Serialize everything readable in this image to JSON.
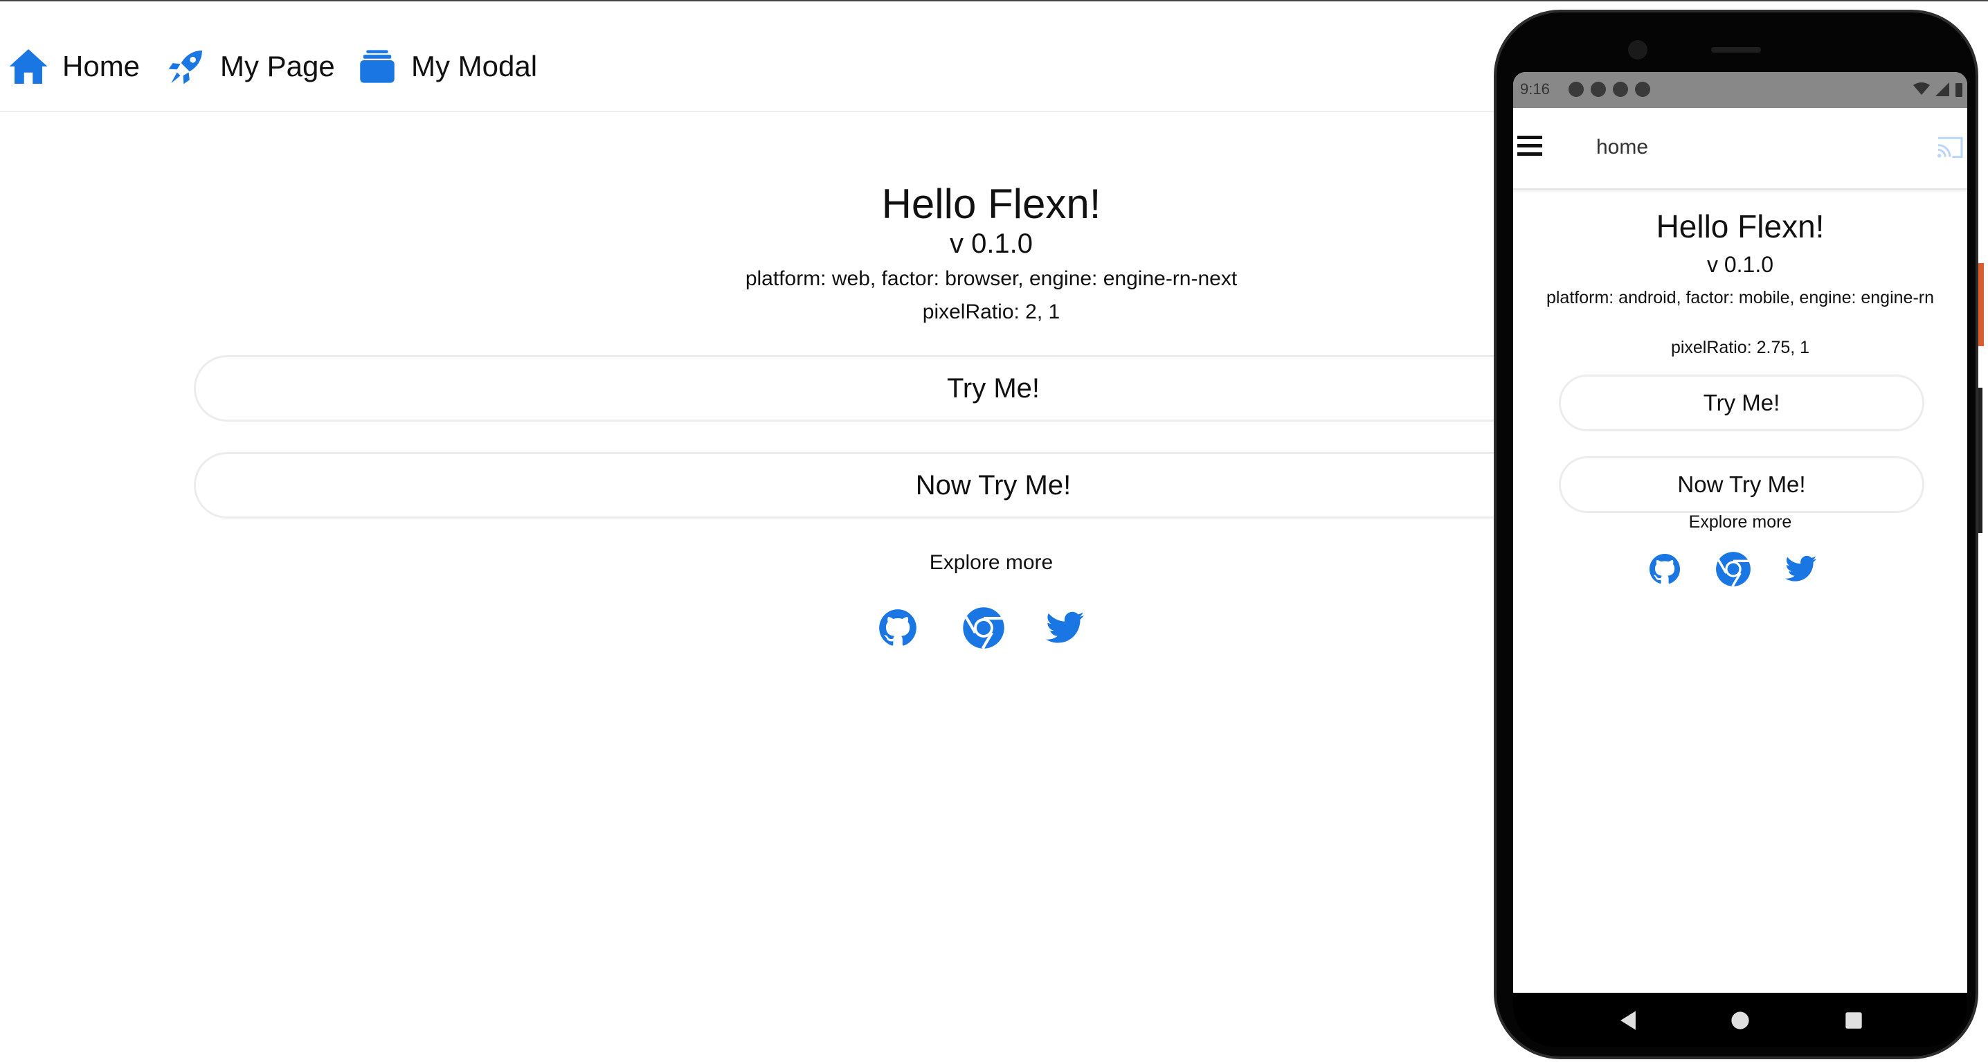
{
  "colors": {
    "accent": "#1976e3",
    "border": "#ececec"
  },
  "nav": {
    "items": [
      {
        "label": "Home",
        "icon": "home-icon"
      },
      {
        "label": "My Page",
        "icon": "rocket-icon"
      },
      {
        "label": "My Modal",
        "icon": "layers-icon"
      }
    ]
  },
  "web": {
    "title": "Hello Flexn!",
    "version": "v 0.1.0",
    "platform_info": "platform: web, factor: browser, engine: engine-rn-next",
    "pixel_ratio": "pixelRatio: 2, 1",
    "button1": "Try Me!",
    "button2": "Now Try Me!",
    "explore": "Explore more",
    "social": [
      "github-icon",
      "chrome-icon",
      "twitter-icon"
    ]
  },
  "phone": {
    "status_time": "9:16",
    "appbar_title": "home",
    "title": "Hello Flexn!",
    "version": "v 0.1.0",
    "platform_info": "platform: android, factor: mobile, engine: engine-rn",
    "pixel_ratio": "pixelRatio: 2.75, 1",
    "button1": "Try Me!",
    "button2": "Now Try Me!",
    "explore": "Explore more"
  }
}
